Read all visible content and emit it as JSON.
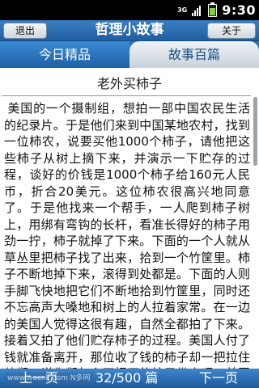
{
  "status_bar": {
    "network": "3G",
    "time": "9:30"
  },
  "title_bar": {
    "back_label": "退出",
    "title": "哲理小故事",
    "about_label": "关于"
  },
  "tabs": [
    {
      "label": "今日精品",
      "active": true
    },
    {
      "label": "故事百篇",
      "active": false
    }
  ],
  "story": {
    "title": "老外买柿子",
    "body": "美国的一个摄制组，想拍一部中国农民生活的纪录片。于是他们来到中国某地农村，找到一位柿农，说要买他1000个柿子，请他把这些柿子从树上摘下来，并演示一下贮存的过程，谈好的价钱是1000个柿子给160元人民币，折合20美元。这位柿农很高兴地同意了。于是他找来一个帮手，一人爬到柿子树上，用绑有弯钩的长杆，看准长得好的柿子用劲一拧，柿子就掉了下来。下面的一个人就从草丛里把柿子找了出来，拾到一个竹筐里。柿子不断地掉下来，滚得到处都是。下面的人则手脚飞快地把它们不断地拾到竹筐里，同时还不忘高声大嗓地和树上的人拉着家常。在一边的美国人觉得这很有趣，自然全都拍了下来。接着又拍了他们贮存柿子的过程。美国人付了钱就准备离开，那位收了钱的柿子却一把拉住他们，说你们怎么不把买的柿子带走呢。美国人说不好带，也不需要带，他们买"
  },
  "bottom_bar": {
    "watermark": "www.wocnk.com N多网",
    "prev_label": "上一页",
    "page_indicator": "32/500 篇",
    "next_label": "下一页"
  },
  "colors": {
    "accent_blue": "#2a6fb4",
    "status_bar": "#000000",
    "battery_green": "#7fd43a"
  }
}
